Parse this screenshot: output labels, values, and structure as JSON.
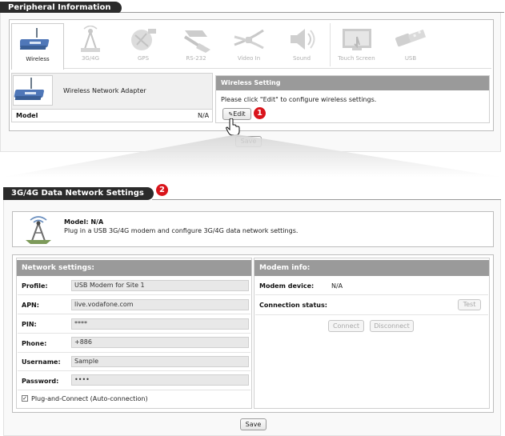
{
  "peripheral": {
    "title": "Peripheral Information",
    "tiles": [
      {
        "label": "Wireless",
        "icon": "wireless-router-icon",
        "active": true
      },
      {
        "label": "3G/4G",
        "icon": "cell-tower-icon",
        "active": false
      },
      {
        "label": "GPS",
        "icon": "gps-satellite-icon",
        "active": false
      },
      {
        "label": "RS-232",
        "icon": "serial-cable-icon",
        "active": false
      },
      {
        "label": "Video In",
        "icon": "video-cable-icon",
        "active": false
      },
      {
        "label": "Sound",
        "icon": "speaker-icon",
        "active": false
      },
      {
        "label": "Touch Screen",
        "icon": "touch-screen-icon",
        "active": false
      },
      {
        "label": "USB",
        "icon": "usb-icon",
        "active": false
      }
    ],
    "device_name": "Wireless Network Adapter",
    "model_label": "Model",
    "model_value": "N/A",
    "wireless_setting_title": "Wireless Setting",
    "wireless_setting_text": "Please click \"Edit\" to configure wireless settings.",
    "edit_label": "Edit",
    "badge1": "1",
    "save_label": "Save"
  },
  "data_network": {
    "title": "3G/4G Data Network Settings",
    "badge2": "2",
    "model_line": "Model: N/A",
    "description": "Plug in a USB 3G/4G modem and configure 3G/4G data network settings.",
    "network_header": "Network settings:",
    "fields": [
      {
        "label": "Profile:",
        "value": "USB Modem for Site 1"
      },
      {
        "label": "APN:",
        "value": "live.vodafone.com"
      },
      {
        "label": "PIN:",
        "value": "****"
      },
      {
        "label": "Phone:",
        "value": "+886"
      },
      {
        "label": "Username:",
        "value": "Sample"
      },
      {
        "label": "Password:",
        "value": "••••"
      }
    ],
    "plug_connect_label": "Plug-and-Connect (Auto-connection)",
    "modem_header": "Modem info:",
    "modem_device_label": "Modem device:",
    "modem_device_value": "N/A",
    "connection_status_label": "Connection status:",
    "test_label": "Test",
    "connect_label": "Connect",
    "disconnect_label": "Disconnect",
    "save_label": "Save"
  }
}
